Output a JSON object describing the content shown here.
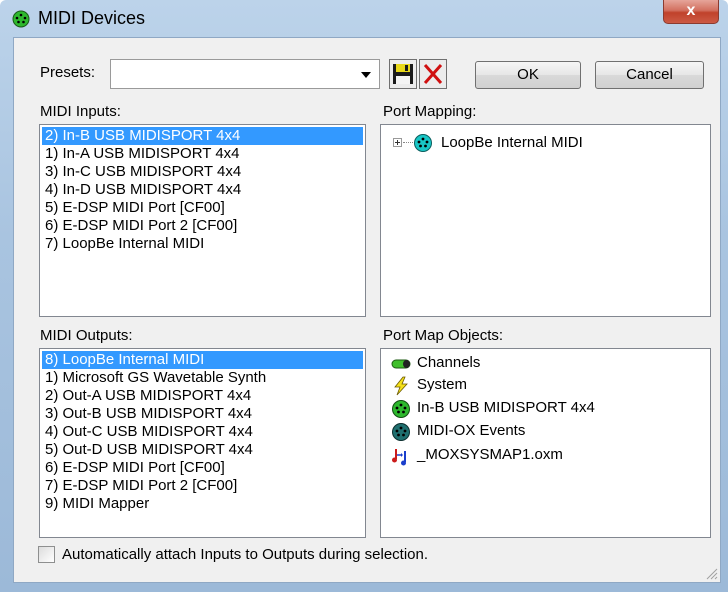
{
  "window": {
    "title": "MIDI Devices",
    "close_glyph": "x",
    "icon": "midi-din-icon"
  },
  "presets": {
    "label": "Presets:",
    "value": ""
  },
  "toolbar": {
    "save_icon": "floppy-save-icon",
    "delete_icon": "red-x-delete-icon",
    "ok_label": "OK",
    "cancel_label": "Cancel"
  },
  "midi_inputs": {
    "label": "MIDI Inputs:",
    "items": [
      "2) In-B USB MIDISPORT 4x4",
      "1) In-A USB MIDISPORT 4x4",
      "3) In-C USB MIDISPORT 4x4",
      "4) In-D USB MIDISPORT 4x4",
      "5) E-DSP MIDI Port [CF00]",
      "6) E-DSP MIDI Port 2 [CF00]",
      "7) LoopBe Internal MIDI"
    ],
    "selected_index": 0
  },
  "port_mapping": {
    "label": "Port Mapping:",
    "nodes": [
      "LoopBe Internal MIDI"
    ]
  },
  "midi_outputs": {
    "label": "MIDI Outputs:",
    "items": [
      "8) LoopBe Internal MIDI",
      "1) Microsoft GS Wavetable Synth",
      "2) Out-A USB MIDISPORT 4x4",
      "3) Out-B USB MIDISPORT 4x4",
      "4) Out-C USB MIDISPORT 4x4",
      "5) Out-D USB MIDISPORT 4x4",
      "6) E-DSP MIDI Port [CF00]",
      "7) E-DSP MIDI Port 2 [CF00]",
      "9) MIDI Mapper"
    ],
    "selected_index": 0
  },
  "port_map_objects": {
    "label": "Port Map Objects:",
    "items": [
      {
        "label": "Channels",
        "icon": "channels-pill-icon"
      },
      {
        "label": "System",
        "icon": "lightning-bolt-icon"
      },
      {
        "label": "In-B USB MIDISPORT 4x4",
        "icon": "midi-port-green-icon"
      },
      {
        "label": "MIDI-OX Events",
        "icon": "midi-port-teal-icon"
      },
      {
        "label": "_MOXSYSMAP1.oxm",
        "icon": "music-note-file-icon"
      }
    ]
  },
  "auto_attach": {
    "label": "Automatically attach Inputs to Outputs during selection.",
    "checked": false
  },
  "colors": {
    "selection": "#3399ff",
    "title_bar": "#a9c4e0",
    "close_button": "#c0422b",
    "dialog_bg": "#f0f0f0"
  }
}
